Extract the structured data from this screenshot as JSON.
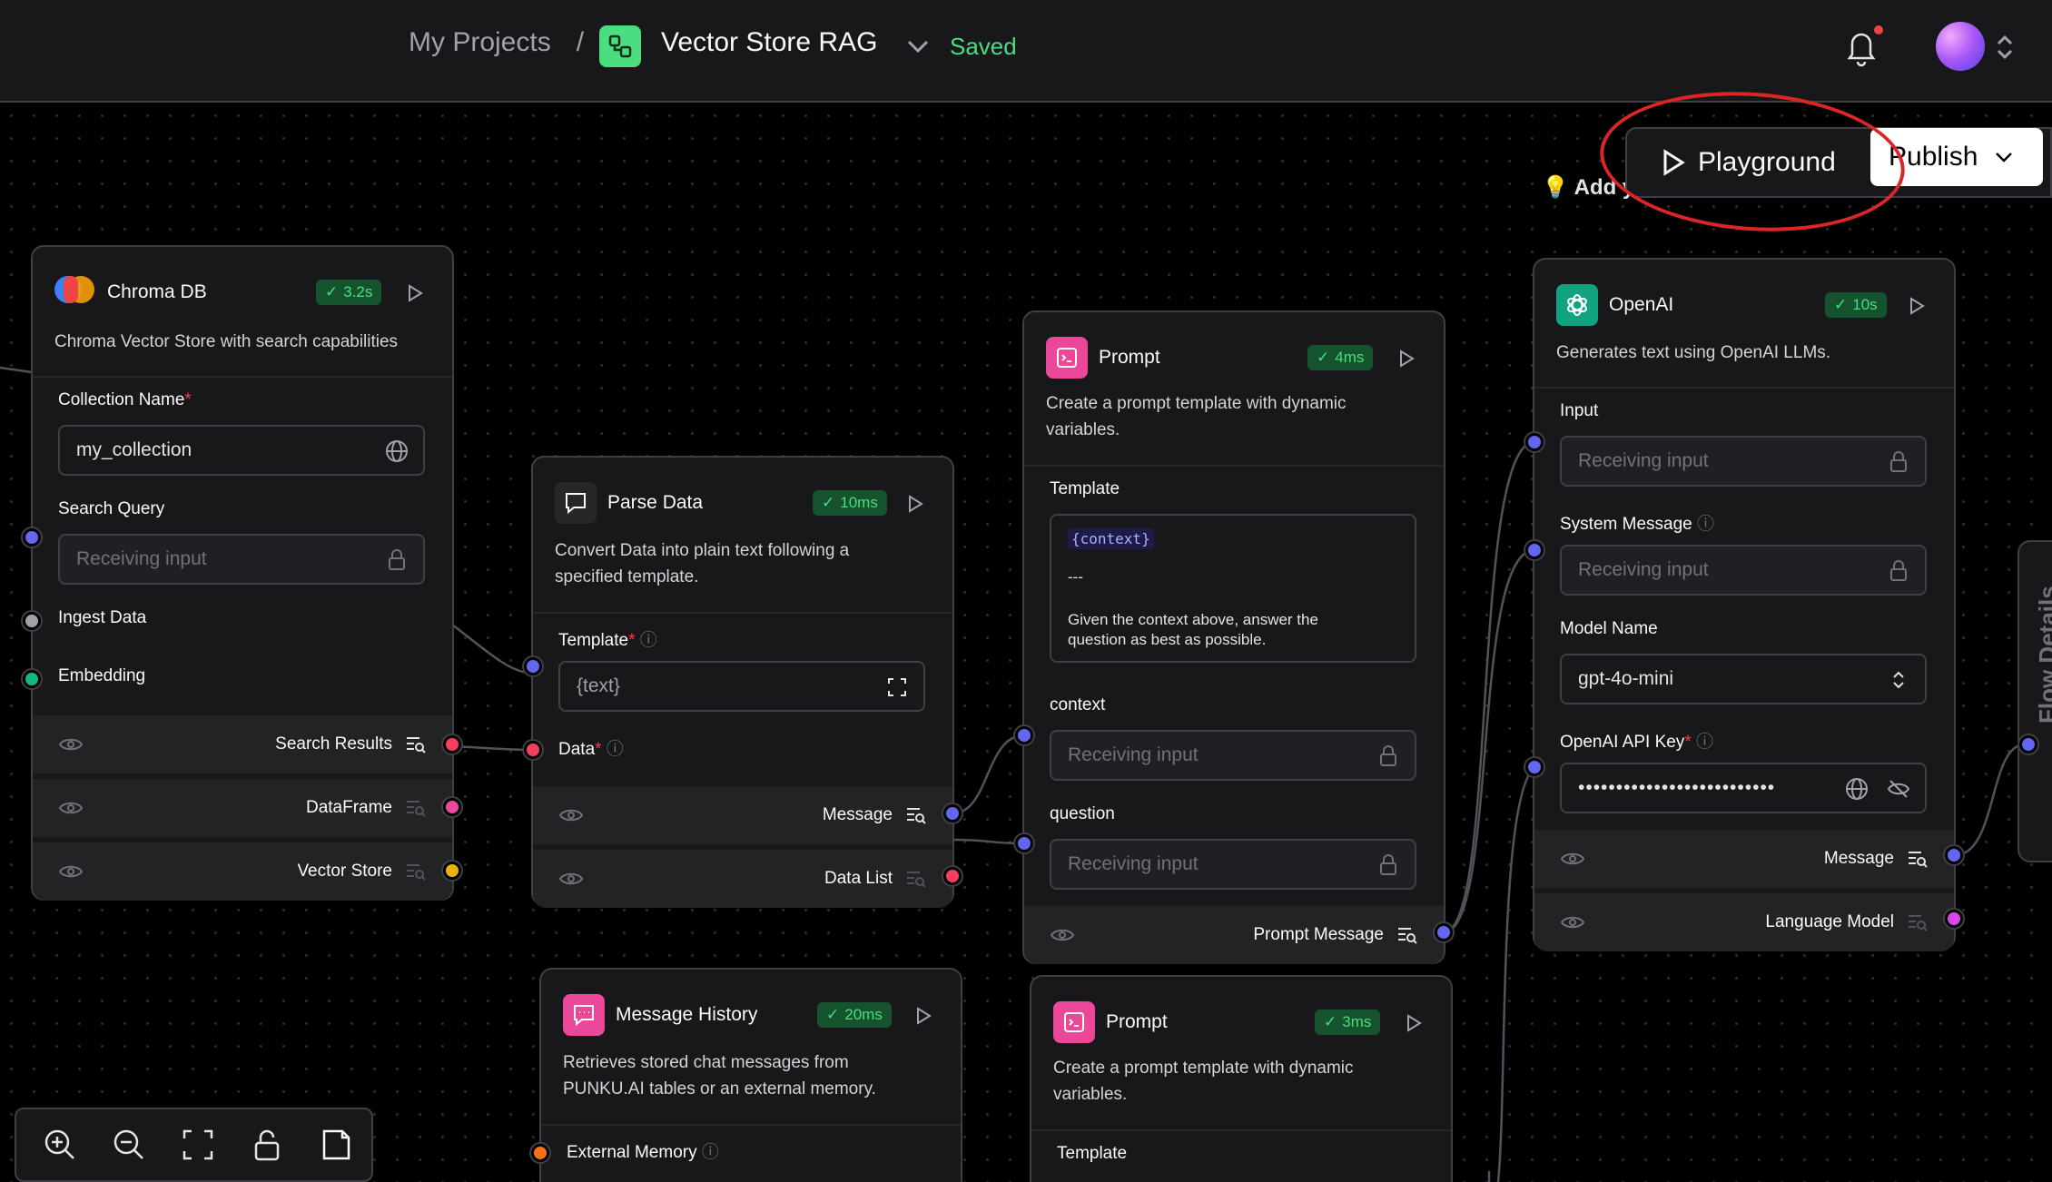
{
  "header": {
    "breadcrumb_root": "My Projects",
    "separator": "/",
    "project_name": "Vector Store RAG",
    "status": "Saved"
  },
  "toolbar": {
    "playground_label": "Playground",
    "publish_label": "Publish"
  },
  "hint": "💡 Add y",
  "flow_details_label": "Flow Details",
  "nodes": {
    "chroma": {
      "title": "Chroma DB",
      "badge": "3.2s",
      "description": "Chroma Vector Store with search capabilities",
      "collection_label": "Collection Name",
      "collection_value": "my_collection",
      "search_label": "Search Query",
      "search_placeholder": "Receiving input",
      "ingest_label": "Ingest Data",
      "embedding_label": "Embedding",
      "outputs": [
        "Search Results",
        "DataFrame",
        "Vector Store"
      ]
    },
    "parse": {
      "title": "Parse Data",
      "badge": "10ms",
      "description_1": "Convert Data into plain text following a",
      "description_2": "specified template.",
      "template_label": "Template",
      "template_value": "{text}",
      "data_label": "Data",
      "outputs": [
        "Message",
        "Data List"
      ]
    },
    "prompt1": {
      "title": "Prompt",
      "badge": "4ms",
      "description_1": "Create a prompt template with dynamic",
      "description_2": "variables.",
      "template_label": "Template",
      "template_tag": "{context}",
      "template_sep": "---",
      "template_line_1": "Given the context above, answer the",
      "template_line_2": "question as best as possible.",
      "context_label": "context",
      "context_placeholder": "Receiving input",
      "question_label": "question",
      "question_placeholder": "Receiving input",
      "output": "Prompt Message"
    },
    "openai": {
      "title": "OpenAI",
      "badge": "10s",
      "description": "Generates text using OpenAI LLMs.",
      "input_label": "Input",
      "input_placeholder": "Receiving input",
      "system_label": "System Message",
      "system_placeholder": "Receiving input",
      "model_label": "Model Name",
      "model_value": "gpt-4o-mini",
      "apikey_label": "OpenAI API Key",
      "apikey_value": "••••••••••••••••••••••••••",
      "outputs": [
        "Message",
        "Language Model"
      ]
    },
    "history": {
      "title": "Message History",
      "badge": "20ms",
      "description_1": "Retrieves stored chat messages from",
      "description_2": "PUNKU.AI tables or an external memory.",
      "external_label": "External Memory"
    },
    "prompt2": {
      "title": "Prompt",
      "badge": "3ms",
      "description_1": "Create a prompt template with dynamic",
      "description_2": "variables.",
      "template_label": "Template"
    }
  },
  "colors": {
    "accent_green": "#4ade80",
    "annotation_red": "#dc2626",
    "handle_blue": "#6366f1",
    "handle_red": "#f43f5e",
    "handle_pink": "#ec4899",
    "handle_yellow": "#eab308"
  },
  "icons": [
    "bell-icon",
    "chevron-down-icon",
    "play-icon",
    "globe-icon",
    "lock-icon",
    "eye-icon",
    "eye-off-icon",
    "zoom-in-icon",
    "zoom-out-icon",
    "fit-view-icon",
    "unlock-icon",
    "note-icon",
    "info-icon",
    "expand-icon",
    "chat-icon",
    "openai-icon",
    "prompt-icon"
  ]
}
